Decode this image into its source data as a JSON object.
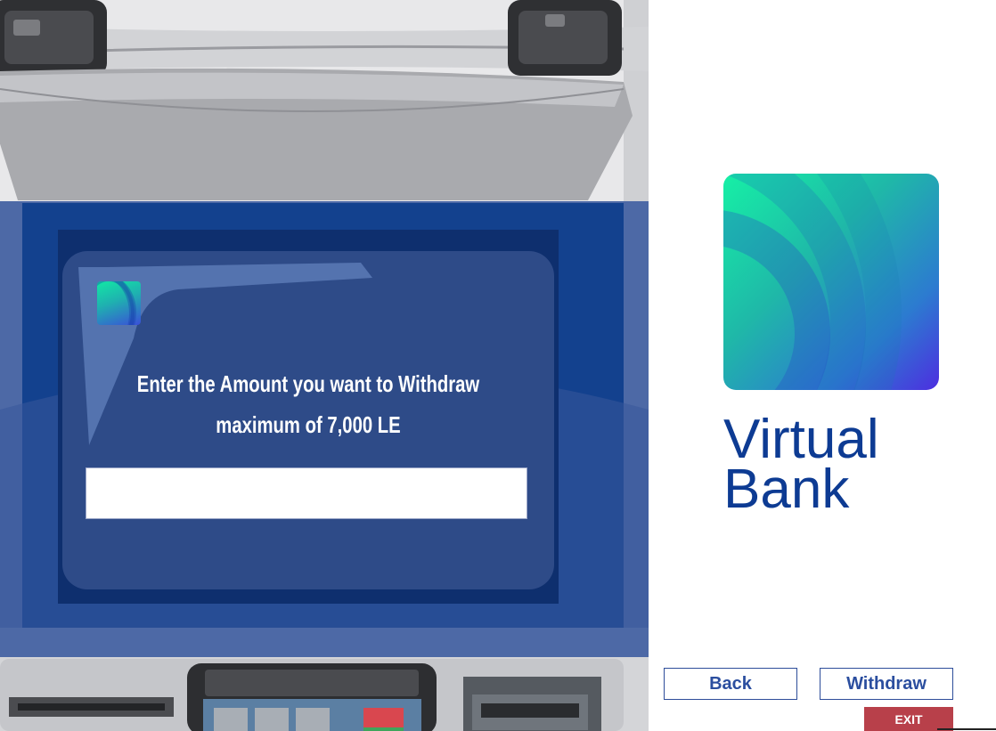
{
  "screen": {
    "prompt_line1": "Enter the Amount you want to Withdraw",
    "prompt_line2": "maximum of  7,000 LE",
    "amount_value": ""
  },
  "brand": {
    "name_line1": "Virtual",
    "name_line2": "Bank"
  },
  "buttons": {
    "back_label": "Back",
    "withdraw_label": "Withdraw",
    "exit_label": "EXIT"
  },
  "colors": {
    "brand_text": "#0d3b93",
    "button_text": "#2b4e9f",
    "exit_bg": "#b8404a",
    "atm_screen": "#2e4b88"
  }
}
